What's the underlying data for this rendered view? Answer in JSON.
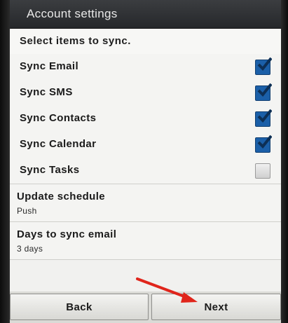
{
  "title_bar": {
    "title": "Account settings"
  },
  "sync_section": {
    "header": "Select items to sync.",
    "items": [
      {
        "label": "Sync Email",
        "checked": true
      },
      {
        "label": "Sync SMS",
        "checked": true
      },
      {
        "label": "Sync Contacts",
        "checked": true
      },
      {
        "label": "Sync Calendar",
        "checked": true
      },
      {
        "label": "Sync Tasks",
        "checked": false
      }
    ]
  },
  "settings": {
    "update_schedule": {
      "title": "Update schedule",
      "value": "Push"
    },
    "days_to_sync": {
      "title": "Days to sync email",
      "value": "3 days"
    }
  },
  "buttons": {
    "back": "Back",
    "next": "Next"
  },
  "colors": {
    "checkbox_checked": "#1b5fa8",
    "annotation_arrow": "#e0251b"
  }
}
